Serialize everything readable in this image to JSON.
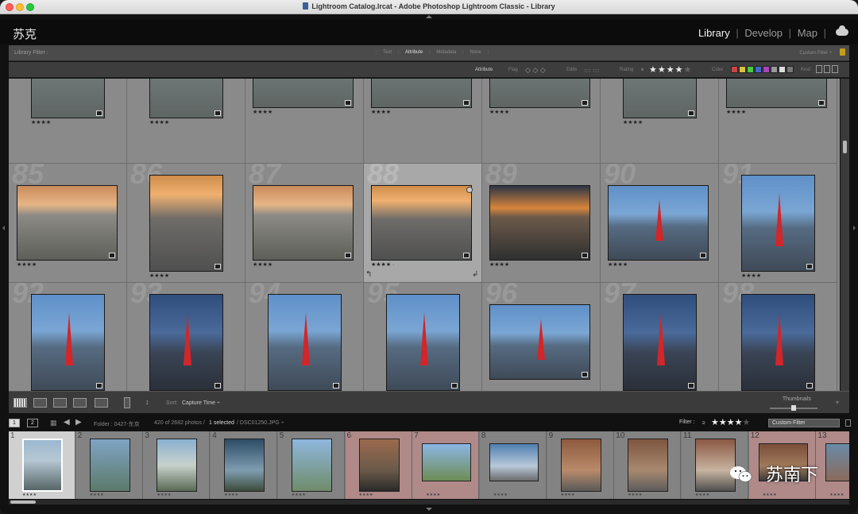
{
  "window": {
    "title": "Lightroom Catalog.lrcat - Adobe Photoshop Lightroom Classic - Library"
  },
  "identity": {
    "plate": "苏克",
    "modules": [
      "Library",
      "Develop",
      "Map"
    ],
    "active_module": "Library",
    "separator": "|"
  },
  "library_filter": {
    "label": "Library Filter :",
    "tabs": [
      "Text",
      "Attribute",
      "Metadata",
      "None"
    ],
    "active_tab": "Attribute",
    "preset": "Custom Filter ÷"
  },
  "attribute_bar": {
    "attribute": "Attribute",
    "flag": "Flag",
    "edits": "Edits",
    "rating": "Rating",
    "rating_op": "≥",
    "rating_value": 4,
    "stars_on": "★★★★",
    "stars_off": "★",
    "color": "Color",
    "kind": "Kind",
    "colors": [
      "#c44",
      "#d6c23a",
      "#4c4",
      "#46c",
      "#a4b",
      "#999",
      "#ddd",
      "#777"
    ]
  },
  "grid": {
    "row_stars": "★★★★",
    "row1_stars": "★★★★",
    "sel_stars": "★★★★ ·",
    "cells": [
      {
        "num": ""
      },
      {
        "num": ""
      },
      {
        "num": ""
      },
      {
        "num": ""
      },
      {
        "num": ""
      },
      {
        "num": ""
      },
      {
        "num": ""
      },
      {
        "num": "85"
      },
      {
        "num": "86"
      },
      {
        "num": "87"
      },
      {
        "num": "88"
      },
      {
        "num": "89"
      },
      {
        "num": "90"
      },
      {
        "num": "91"
      },
      {
        "num": "92"
      },
      {
        "num": "93"
      },
      {
        "num": "94"
      },
      {
        "num": "95"
      },
      {
        "num": "96"
      },
      {
        "num": "97"
      },
      {
        "num": "98"
      }
    ]
  },
  "toolbar": {
    "sort_label": "Sort:",
    "sort_value": "Capture Time ÷",
    "thumbnails": "Thumbnails"
  },
  "filmstrip_nav": {
    "page1": "1",
    "page2": "2",
    "folder": "Folder : 0427-东京",
    "count": "420 of 2682 photos /",
    "selected": "1 selected",
    "file": "/ DSC01250.JPG ÷",
    "filter_label": "Filter :",
    "filter_op": "≥",
    "filter_stars_on": "★★★★",
    "filter_stars_off": "★",
    "filter_preset": "Custom Filter"
  },
  "filmstrip": {
    "stars": "★★★★",
    "cells": [
      {
        "num": "1"
      },
      {
        "num": "2"
      },
      {
        "num": "3"
      },
      {
        "num": "4"
      },
      {
        "num": "5"
      },
      {
        "num": "6"
      },
      {
        "num": "7"
      },
      {
        "num": "8"
      },
      {
        "num": "9"
      },
      {
        "num": "10"
      },
      {
        "num": "11"
      },
      {
        "num": "12"
      },
      {
        "num": "13"
      }
    ]
  },
  "watermark": "苏南下"
}
